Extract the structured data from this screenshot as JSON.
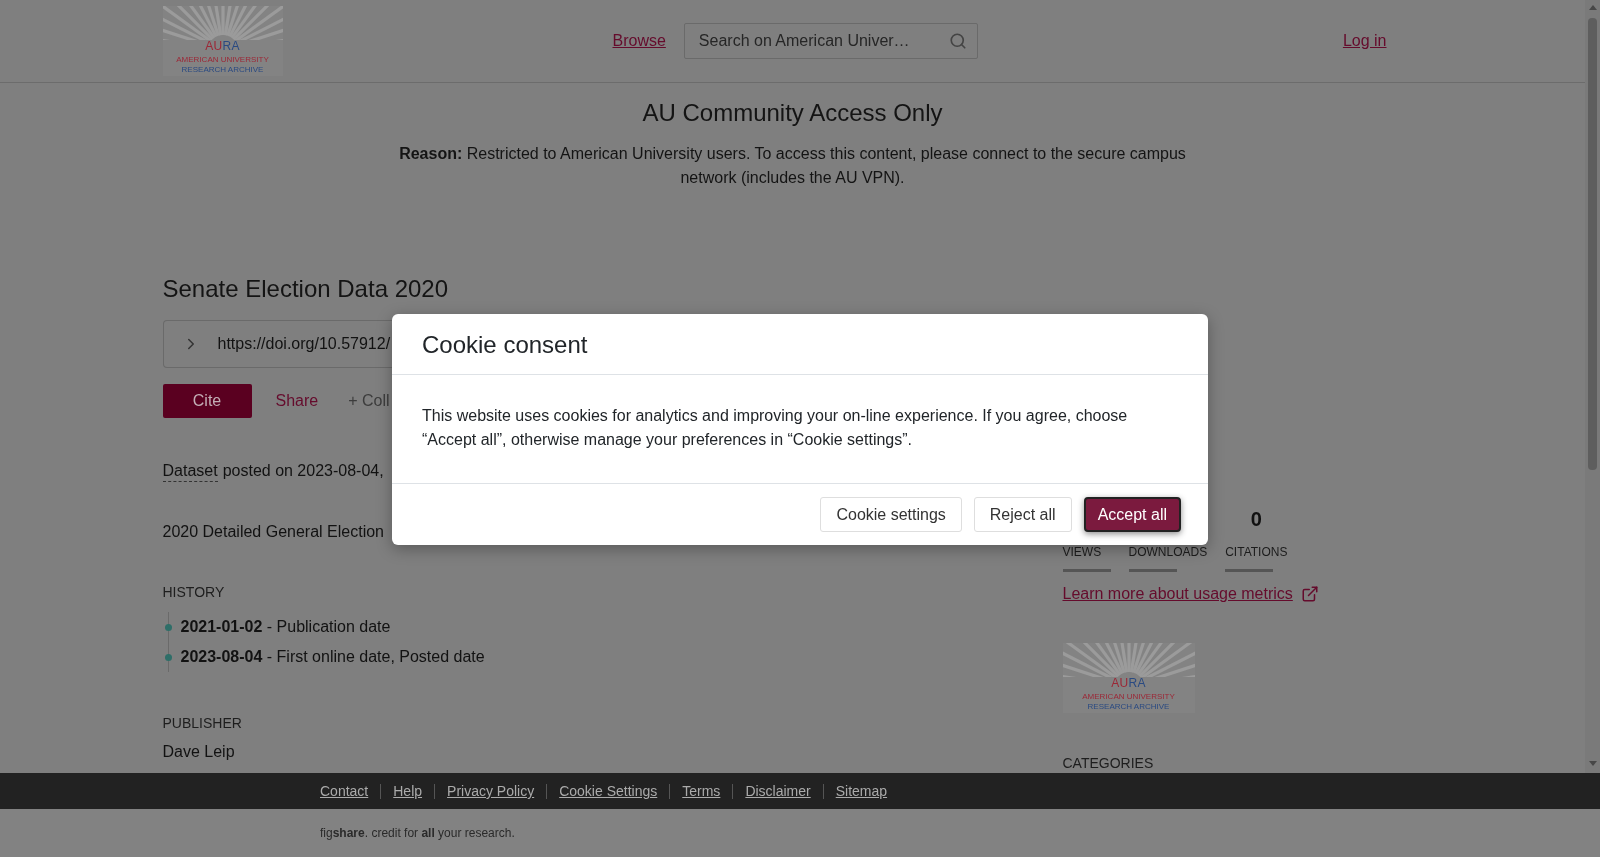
{
  "header": {
    "logo": {
      "mark_left": "AU",
      "mark_right": "RA",
      "tagline_1": "AMERICAN UNIVERSITY",
      "tagline_2": "RESEARCH ARCHIVE"
    },
    "nav_link": "Browse",
    "search": {
      "placeholder": "Search on American Univer…"
    },
    "login": "Log in"
  },
  "notice": {
    "title": "AU Community Access Only",
    "reason": "**Reason:** Restricted to American University users. To access this content, please connect to the secure campus network (includes the AU VPN)."
  },
  "item": {
    "title": "Senate Election Data 2020",
    "doi": "https://doi.org/10.57912/",
    "actions": [
      {
        "kind": "primary",
        "label": "Cite"
      },
      {
        "kind": "link",
        "label": "Share"
      },
      {
        "kind": "muted",
        "label": "+ Coll"
      }
    ],
    "type": "Dataset",
    "posted": "posted on 2023-08-04,",
    "description": "2020 Detailed General Election",
    "history": {
      "title": "HISTORY",
      "items": [
        "**2021-01-02** - Publication date",
        "**2023-08-04** - First online date, Posted date"
      ]
    },
    "publisher": {
      "title": "PUBLISHER",
      "name": "Dave Leip"
    }
  },
  "sidebar": {
    "stats": [
      {
        "label": "VIEWS"
      },
      {
        "label": "DOWNLOADS"
      },
      {
        "value": "0",
        "label": "CITATIONS"
      }
    ],
    "metrics_link": "Learn more about usage metrics",
    "logo": {
      "mark_left": "AU",
      "mark_right": "RA",
      "tagline_1": "AMERICAN UNIVERSITY",
      "tagline_2": "RESEARCH ARCHIVE"
    },
    "categories_title": "CATEGORIES"
  },
  "cookie_dialog": {
    "title": "Cookie consent",
    "message": "This website uses cookies for analytics and improving your on-line experience. If you agree, choose “Accept all”, otherwise manage your preferences in “Cookie settings”.",
    "buttons": [
      {
        "kind": "secondary",
        "label": "Cookie settings",
        "focused": false
      },
      {
        "kind": "secondary",
        "label": "Reject all",
        "focused": false
      },
      {
        "kind": "primary",
        "label": "Accept all",
        "focused": true
      }
    ]
  },
  "footer": {
    "links": [
      "Contact",
      "Help",
      "Privacy Policy",
      "Cookie Settings",
      "Terms",
      "Disclaimer",
      "Sitemap"
    ],
    "credit": "fig**share**. credit for **all** your research."
  }
}
